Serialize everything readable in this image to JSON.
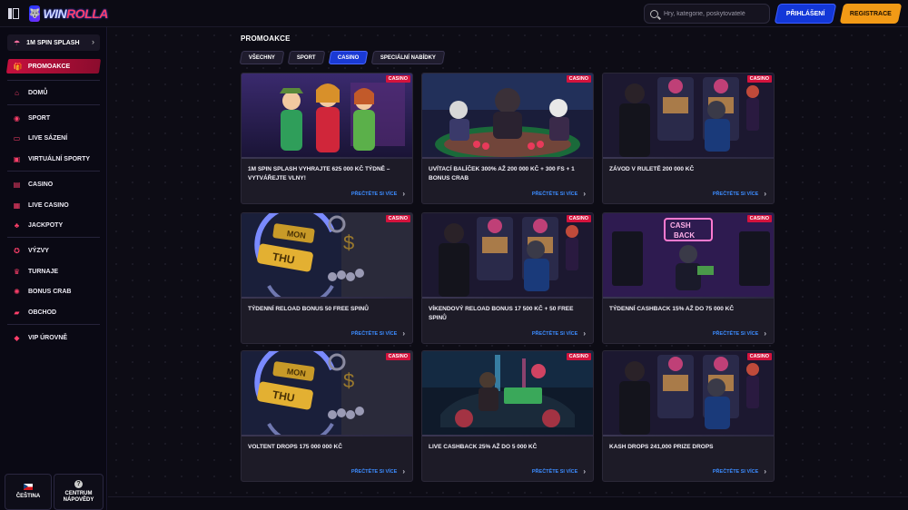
{
  "header": {
    "logo_text_1": "WIN",
    "logo_text_2": "ROLLA",
    "search_placeholder": "Hry, kategorie, poskytovatelé",
    "login_label": "PŘIHLÁŠENÍ",
    "register_label": "REGISTRACE"
  },
  "sidebar": {
    "spin_banner": "1M SPIN SPLASH",
    "promo": "PROMOAKCE",
    "items": [
      {
        "label": "DOMŮ",
        "icon": "home-icon"
      },
      {
        "label": "SPORT",
        "icon": "ball-icon"
      },
      {
        "label": "LIVE SÁZENÍ",
        "icon": "live-icon"
      },
      {
        "label": "VIRTUÁLNÍ SPORTY",
        "icon": "virtual-icon"
      },
      {
        "label": "CASINO",
        "icon": "casino-icon"
      },
      {
        "label": "LIVE CASINO",
        "icon": "live-casino-icon"
      },
      {
        "label": "JACKPOTY",
        "icon": "jackpot-icon"
      },
      {
        "label": "VÝZVY",
        "icon": "challenge-icon"
      },
      {
        "label": "TURNAJE",
        "icon": "trophy-icon"
      },
      {
        "label": "BONUS CRAB",
        "icon": "crab-icon"
      },
      {
        "label": "OBCHOD",
        "icon": "shop-icon"
      },
      {
        "label": "VIP ÚROVNĚ",
        "icon": "diamond-icon"
      }
    ],
    "language": "ČEŠTINA",
    "help_1": "CENTRUM",
    "help_2": "NÁPOVĚDY"
  },
  "main": {
    "title": "PROMOAKCE",
    "filters": [
      {
        "label": "VŠECHNY",
        "active": false
      },
      {
        "label": "SPORT",
        "active": false
      },
      {
        "label": "CASINO",
        "active": true
      },
      {
        "label": "SPECIÁLNÍ NABÍDKY",
        "active": false
      }
    ],
    "read_more": "PŘEČTĚTE SI VÍCE",
    "cards": [
      {
        "badge": "CASINO",
        "title": "1M SPIN SPLASH VYHRAJTE 625 000 KČ TÝDNĚ – VYTVÁŘEJTE VLNY!",
        "image": "three-women-slot-art"
      },
      {
        "badge": "CASINO",
        "title": "UVÍTACÍ BALÍČEK 300% AŽ 200 000 KČ + 300 FS + 1 BONUS CRAB",
        "image": "animals-poker-table"
      },
      {
        "badge": "CASINO",
        "title": "ZÁVOD V RULETĚ 200 000 KČ",
        "image": "animals-slot-machines"
      },
      {
        "badge": "CASINO",
        "title": "TÝDENNÍ RELOAD BONUS 50 FREE SPINŮ",
        "image": "gold-bars-mon-thu"
      },
      {
        "badge": "CASINO",
        "title": "VÍKENDOVÝ RELOAD BONUS 17 500 KČ + 50 FREE SPINŮ",
        "image": "animals-slot-machines"
      },
      {
        "badge": "CASINO",
        "title": "TÝDENNÍ CASHBACK 15% AŽ DO 75 000 KČ",
        "image": "cashback-neon-sign"
      },
      {
        "badge": "CASINO",
        "title": "VOLTENT DROPS 175 000 000 KČ",
        "image": "gold-bars-mon-thu"
      },
      {
        "badge": "CASINO",
        "title": "LIVE CASHBACK 25% AŽ DO 5 000 KČ",
        "image": "wolf-in-car"
      },
      {
        "badge": "CASINO",
        "title": "KASH DROPS 241,000 PRIZE DROPS",
        "image": "animals-slot-machines"
      }
    ]
  },
  "colors": {
    "accent_red": "#d4133d",
    "accent_blue": "#1337d8",
    "accent_orange": "#f29a16",
    "link_blue": "#3c8cff"
  }
}
